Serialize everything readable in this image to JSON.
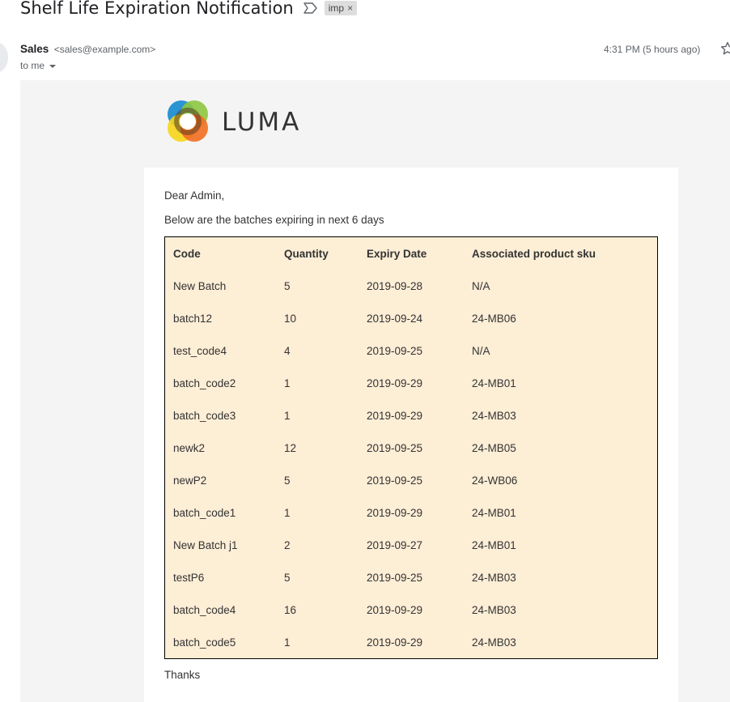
{
  "header": {
    "subject": "Shelf Life Expiration Notification",
    "label": "imp",
    "label_remove": "×"
  },
  "sender": {
    "name": "Sales",
    "email": "<sales@example.com>",
    "to": "to me",
    "timestamp": "4:31 PM (5 hours ago)"
  },
  "email": {
    "brand": "LUMA",
    "greeting": "Dear Admin,",
    "intro": "Below are the batches expiring in next 6 days",
    "table": {
      "headers": [
        "Code",
        "Quantity",
        "Expiry Date",
        "Associated product sku"
      ],
      "rows": [
        [
          "New Batch",
          "5",
          "2019-09-28",
          "N/A"
        ],
        [
          "batch12",
          "10",
          "2019-09-24",
          "24-MB06"
        ],
        [
          "test_code4",
          "4",
          "2019-09-25",
          "N/A"
        ],
        [
          "batch_code2",
          "1",
          "2019-09-29",
          "24-MB01"
        ],
        [
          "batch_code3",
          "1",
          "2019-09-29",
          "24-MB03"
        ],
        [
          "newk2",
          "12",
          "2019-09-25",
          "24-MB05"
        ],
        [
          "newP2",
          "5",
          "2019-09-25",
          "24-WB06"
        ],
        [
          "batch_code1",
          "1",
          "2019-09-29",
          "24-MB01"
        ],
        [
          "New Batch j1",
          "2",
          "2019-09-27",
          "24-MB01"
        ],
        [
          "testP6",
          "5",
          "2019-09-25",
          "24-MB03"
        ],
        [
          "batch_code4",
          "16",
          "2019-09-29",
          "24-MB03"
        ],
        [
          "batch_code5",
          "1",
          "2019-09-29",
          "24-MB03"
        ]
      ]
    },
    "closing": "Thanks"
  },
  "colors": {
    "table_bg": "#fdeed6",
    "email_bg": "#f4f4f4",
    "logo_blue": "#1f8fd0",
    "logo_green": "#8dc63f",
    "logo_yellow": "#f7d51a",
    "logo_orange": "#f26f21"
  },
  "icons": {
    "importance": "importance-marker-icon",
    "star": "star-icon",
    "caret": "chevron-down-icon",
    "logo": "luma-logo-icon"
  }
}
